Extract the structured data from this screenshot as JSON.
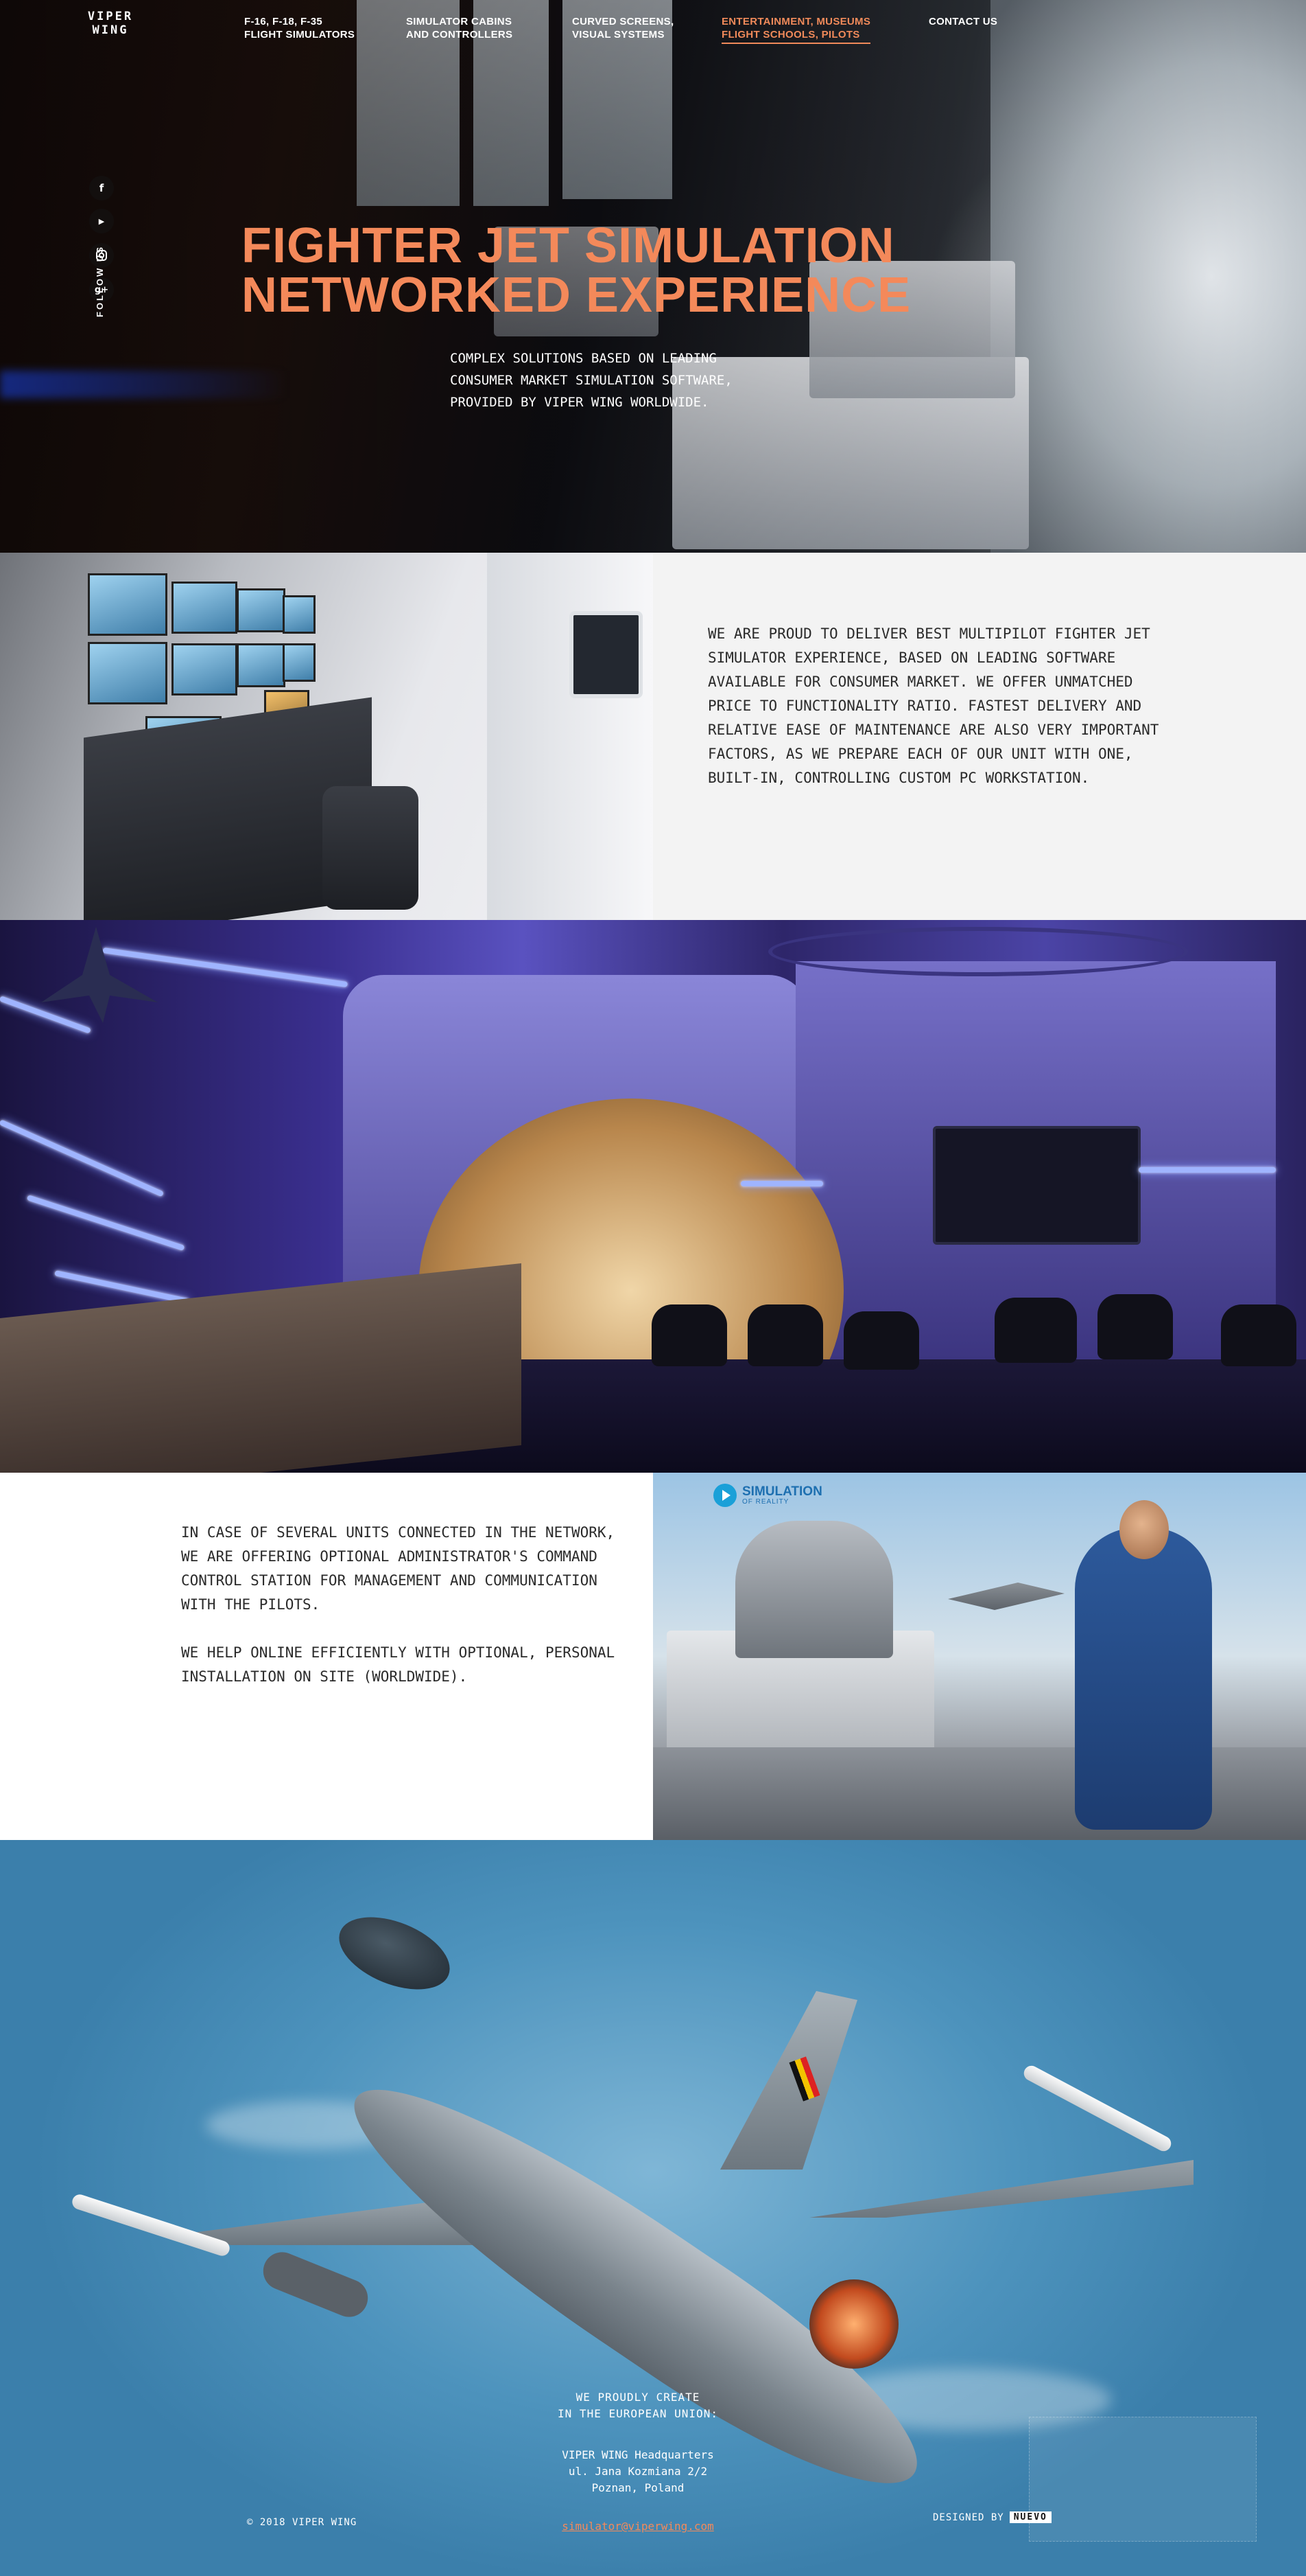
{
  "brand": {
    "logo_line1": "VIPER",
    "logo_line2": "WING"
  },
  "nav": [
    {
      "line1": "F-16, F-18, F-35",
      "line2": "FLIGHT SIMULATORS",
      "active": false
    },
    {
      "line1": "SIMULATOR CABINS",
      "line2": "AND CONTROLLERS",
      "active": false
    },
    {
      "line1": "CURVED SCREENS,",
      "line2": "VISUAL SYSTEMS",
      "active": false
    },
    {
      "line1": "ENTERTAINMENT, MUSEUMS",
      "line2": "FLIGHT SCHOOLS, PILOTS",
      "active": true
    },
    {
      "line1": "CONTACT US",
      "line2": "",
      "active": false
    }
  ],
  "social": {
    "follow_label": "FOLLOW US",
    "icons": [
      "facebook-icon",
      "youtube-icon",
      "instagram-icon",
      "google-plus-icon"
    ]
  },
  "hero": {
    "title_line1": "FIGHTER JET SIMULATION",
    "title_line2": "NETWORKED EXPERIENCE",
    "sub_line1": "COMPLEX SOLUTIONS BASED ON LEADING",
    "sub_line2": "CONSUMER MARKET SIMULATION SOFTWARE,",
    "sub_line3": "PROVIDED BY VIPER WING WORLDWIDE."
  },
  "section2": {
    "text": "WE ARE PROUD TO DELIVER BEST MULTIPILOT FIGHTER JET SIMULATOR EXPERIENCE, BASED ON LEADING SOFTWARE AVAILABLE FOR CONSUMER MARKET. WE OFFER UNMATCHED PRICE TO FUNCTIONALITY RATIO. FASTEST DELIVERY AND RELATIVE EASE OF MAINTENANCE ARE ALSO VERY IMPORTANT FACTORS, AS WE PREPARE EACH OF OUR UNIT WITH ONE, BUILT-IN, CONTROLLING CUSTOM PC WORKSTATION."
  },
  "section4": {
    "p1": "IN CASE OF SEVERAL UNITS CONNECTED IN THE NETWORK, WE ARE OFFERING OPTIONAL ADMINISTRATOR'S COMMAND CONTROL STATION FOR MANAGEMENT AND COMMUNICATION WITH THE PILOTS.",
    "p2": "WE HELP ONLINE EFFICIENTLY WITH OPTIONAL, PERSONAL INSTALLATION ON SITE (WORLDWIDE).",
    "photo_logo_line1": "SIMULATION",
    "photo_logo_line2": "OF REALITY"
  },
  "footer": {
    "tag_line1": "WE PROUDLY CREATE",
    "tag_line2": "IN THE EUROPEAN UNION:",
    "addr_line1": "VIPER WING Headquarters",
    "addr_line2": "ul. Jana Kozmiana 2/2",
    "addr_line3": "Poznan, Poland",
    "email": "simulator@viperwing.com",
    "copyright": "© 2018 VIPER WING",
    "designed_by": "DESIGNED BY",
    "designer": "NUEVO"
  },
  "colors": {
    "accent": "#f4895a",
    "panel_light": "#f3f3f3",
    "text_dark": "#2a2a2a"
  }
}
